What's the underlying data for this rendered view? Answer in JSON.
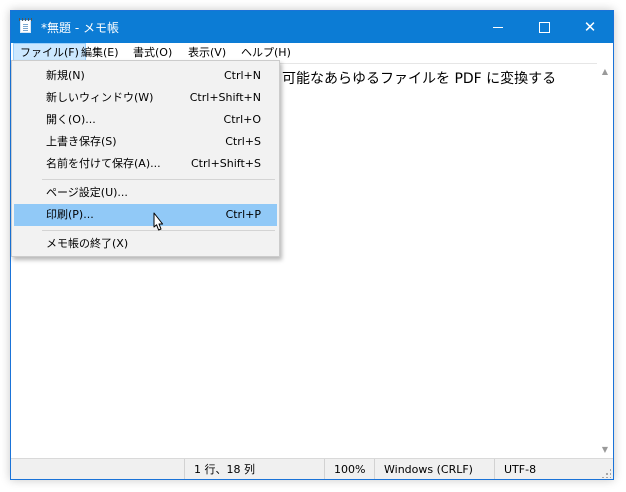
{
  "window": {
    "title": "*無題 - メモ帳",
    "minimize": "–",
    "close": "✕",
    "accent": "#0c7cd5"
  },
  "menubar": {
    "file": "ファイル(F)",
    "edit": "編集(E)",
    "format": "書式(O)",
    "view": "表示(V)",
    "help": "ヘルプ(H)"
  },
  "editor": {
    "text": "可能なあらゆるファイルを PDF に変換する"
  },
  "file_menu": {
    "items": [
      {
        "label": "新規(N)",
        "shortcut": "Ctrl+N"
      },
      {
        "label": "新しいウィンドウ(W)",
        "shortcut": "Ctrl+Shift+N"
      },
      {
        "label": "開く(O)...",
        "shortcut": "Ctrl+O"
      },
      {
        "label": "上書き保存(S)",
        "shortcut": "Ctrl+S"
      },
      {
        "label": "名前を付けて保存(A)...",
        "shortcut": "Ctrl+Shift+S"
      },
      {
        "label": "ページ設定(U)...",
        "shortcut": ""
      },
      {
        "label": "印刷(P)...",
        "shortcut": "Ctrl+P"
      },
      {
        "label": "メモ帳の終了(X)",
        "shortcut": ""
      }
    ],
    "highlight_color": "#91c9f7"
  },
  "statusbar": {
    "position": "1 行、18 列",
    "zoom": "100%",
    "line_ending": "Windows (CRLF)",
    "encoding": "UTF-8"
  },
  "icons": {
    "app": "notepad-icon",
    "cursor": "mouse-pointer-icon",
    "scroll_up": "chevron-up-icon",
    "scroll_down": "chevron-down-icon"
  }
}
